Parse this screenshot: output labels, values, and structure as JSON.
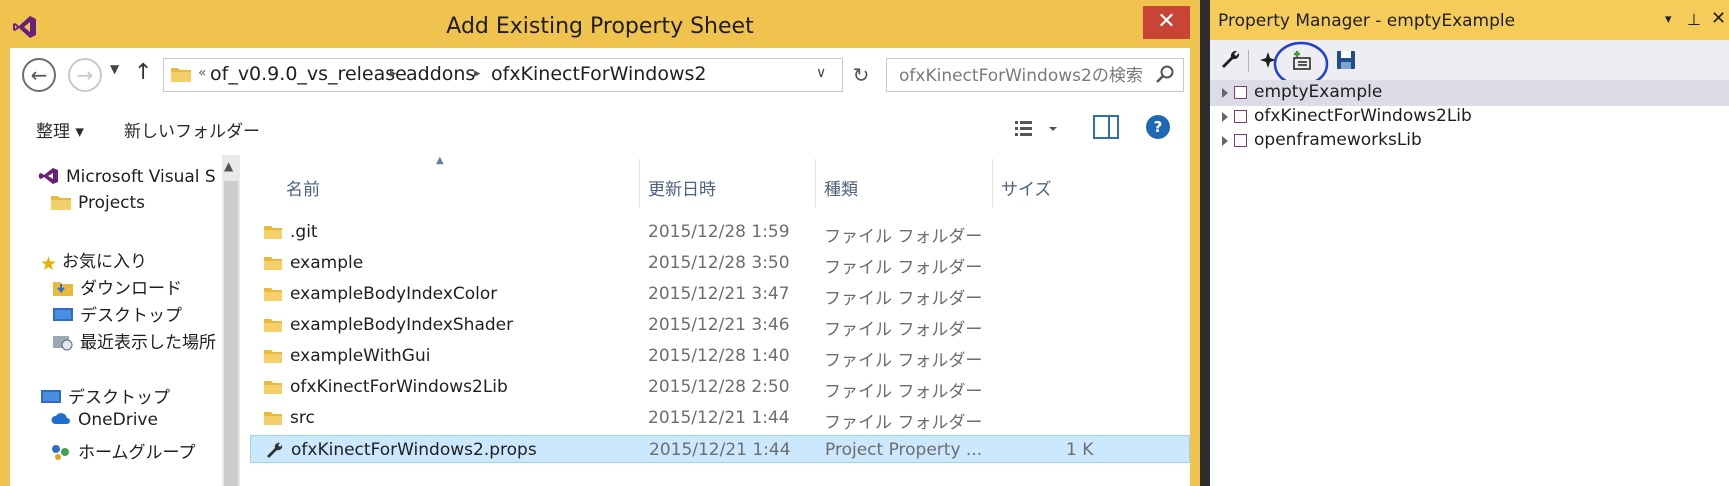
{
  "dialog": {
    "title": "Add Existing Property Sheet",
    "close_label": "✕",
    "address": {
      "chevron": "«",
      "crumbs": [
        "of_v0.9.0_vs_release",
        "addons",
        "ofxKinectForWindows2"
      ],
      "separator": "▸"
    },
    "search": {
      "placeholder": "ofxKinectForWindows2の検索"
    },
    "commands": {
      "organize": "整理 ▾",
      "new_folder": "新しいフォルダー",
      "help": "?"
    },
    "nav": {
      "items": [
        {
          "label": "Microsoft Visual S",
          "icon": "vs-icon"
        },
        {
          "label": "Projects",
          "icon": "folder-icon"
        },
        {
          "label": "お気に入り",
          "icon": "star-icon"
        },
        {
          "label": "ダウンロード",
          "icon": "downloads-icon"
        },
        {
          "label": "デスクトップ",
          "icon": "desktop-icon"
        },
        {
          "label": "最近表示した場所",
          "icon": "recent-icon"
        },
        {
          "label": "デスクトップ",
          "icon": "desktop-icon"
        },
        {
          "label": "OneDrive",
          "icon": "cloud-icon"
        },
        {
          "label": "ホームグループ",
          "icon": "homegroup-icon"
        }
      ]
    },
    "columns": {
      "name": "名前",
      "date": "更新日時",
      "type": "種類",
      "size": "サイズ"
    },
    "files": [
      {
        "name": ".git",
        "date": "2015/12/28 1:59",
        "type": "ファイル フォルダー",
        "size": "",
        "icon": "folder-icon"
      },
      {
        "name": "example",
        "date": "2015/12/28 3:50",
        "type": "ファイル フォルダー",
        "size": "",
        "icon": "folder-icon"
      },
      {
        "name": "exampleBodyIndexColor",
        "date": "2015/12/21 3:47",
        "type": "ファイル フォルダー",
        "size": "",
        "icon": "folder-icon"
      },
      {
        "name": "exampleBodyIndexShader",
        "date": "2015/12/21 3:46",
        "type": "ファイル フォルダー",
        "size": "",
        "icon": "folder-icon"
      },
      {
        "name": "exampleWithGui",
        "date": "2015/12/28 1:40",
        "type": "ファイル フォルダー",
        "size": "",
        "icon": "folder-icon"
      },
      {
        "name": "ofxKinectForWindows2Lib",
        "date": "2015/12/28 2:50",
        "type": "ファイル フォルダー",
        "size": "",
        "icon": "folder-icon"
      },
      {
        "name": "src",
        "date": "2015/12/21 1:44",
        "type": "ファイル フォルダー",
        "size": "",
        "icon": "folder-icon"
      },
      {
        "name": "ofxKinectForWindows2.props",
        "date": "2015/12/21 1:44",
        "type": "Project Property ...",
        "size": "1 K",
        "icon": "wrench-icon",
        "selected": true
      }
    ]
  },
  "property_manager": {
    "title": "Property Manager - emptyExample",
    "controls": {
      "dropdown": "▾",
      "pin": "⊥",
      "close": "✕"
    },
    "tree": [
      {
        "label": "emptyExample",
        "selected": true
      },
      {
        "label": "ofxKinectForWindows2Lib",
        "selected": false
      },
      {
        "label": "openframeworksLib",
        "selected": false
      }
    ]
  },
  "colors": {
    "title_bar": "#f0c34e",
    "pm_title": "#f5cc59",
    "selection": "#cce8ff",
    "close": "#c74436",
    "accent": "#1f68b8"
  }
}
